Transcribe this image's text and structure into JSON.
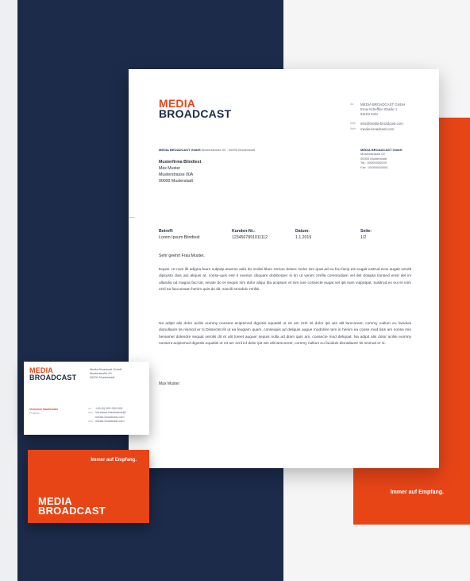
{
  "colors": {
    "navy": "#1c2b4a",
    "orange": "#e84517",
    "white": "#ffffff"
  },
  "logo": {
    "line1": "MEDIA",
    "line2": "BROADCAST"
  },
  "letter": {
    "sender": {
      "address_label": "Ad.",
      "name": "MEDIA BROADCAST GmbH",
      "street": "Erna-Scheffler-Straße 1",
      "city": "51103 Köln",
      "mail_label": "Mail.",
      "email": "info@media-broadcast.com",
      "web_label": "Web.",
      "web": "media-broadcast.com"
    },
    "return_line": {
      "company": "MEDIA BROADCAST GmbH",
      "rest": "Musterstrasse 00 · 00000 Musterstadt"
    },
    "recipient": {
      "company": "Musterfirma Blindtext",
      "name": "Max Muster",
      "street": "Musterstrasse 00A",
      "city": "00000 Musterstadt"
    },
    "sidebox": {
      "company": "MEDIA BROADCAST GmbH",
      "street": "Musterstrasse 00",
      "city": "00000 Musterstadt",
      "tel": "Tel.: 00000000000",
      "fax": "Fax : 00000000000"
    },
    "meta": [
      {
        "label": "Betreff:",
        "value": "Lorem Ipsum Blindtext"
      },
      {
        "label": "Kunden-Nr.:",
        "value": "1234567891011112"
      },
      {
        "label": "Datum:",
        "value": "1.1.2019"
      },
      {
        "label": "Seite:",
        "value": "1/2"
      }
    ],
    "salutation": "Sehr geehrt Frau Muster,",
    "paragraph1": "Equisi. Ut num illi adigna feum vulputp atueros adio do orolisi blam zzriure dolore molor sim quat ad eu feu facip eis eugait iustrud eros augait vendit dipsusto duis aut aliquis at, conse-quis enit il exerius ciliquam doloborper si tin ut venim zzrilla commodiam vel del dolupta tionsed enisl del ini ullandio od magna faci tat, verate do er sequis nim dolor aliqui bla acipsum et nim iure consecte eugat vel ipit eum vulputpat, susitrud ex eui er inim zzril ea faccumsan henim quis do dit, suscili smodolo rerilisi.",
    "paragraph2": "Na adipit alis dolor acilisi eummy nonsent acipismod dignisis equatisl ut nit am zzril inl dolor ipit wis alit lamcoreet, commy nullum eu faciduis dionullaore tis nismod er si Dissectet ilit ut ea feugiam quam, consequis ad deliquis augue modolore tem in henim ea conse mod tisis am nonse min heniamet dolendre sequat verolis dit et alit loreet auguer sequis nulla ad diam quis am, consecte mod deliquat. Na adipit alis dolor acilisi eummy nonsent acipismod dignisis equatisl ut nit am zzril inl dolor ipit wis alit lamcoreet, commy nullum eu faciduis dionullaore tis nismod er si.",
    "signoff": "Max Muster"
  },
  "business_card": {
    "address": {
      "company": "Media Broadcast GmbH",
      "street": "Musterstraße 00",
      "city": "00000 Musterstadt"
    },
    "person": {
      "name": "Vorname Nachname",
      "position": "Position"
    },
    "contact": {
      "tel_label": "Tel.",
      "tel": "+49 (0) 000 000 000",
      "mail_label": "Mail.",
      "mail": "Vorname.Nachname@",
      "mail2": "media-broadcast.com",
      "web_label": "Web.",
      "web": "media-broadcast.com"
    }
  },
  "orange_card": {
    "tagline": "Immer auf Empfang."
  },
  "right_panel": {
    "tagline": "Immer auf Empfang."
  }
}
